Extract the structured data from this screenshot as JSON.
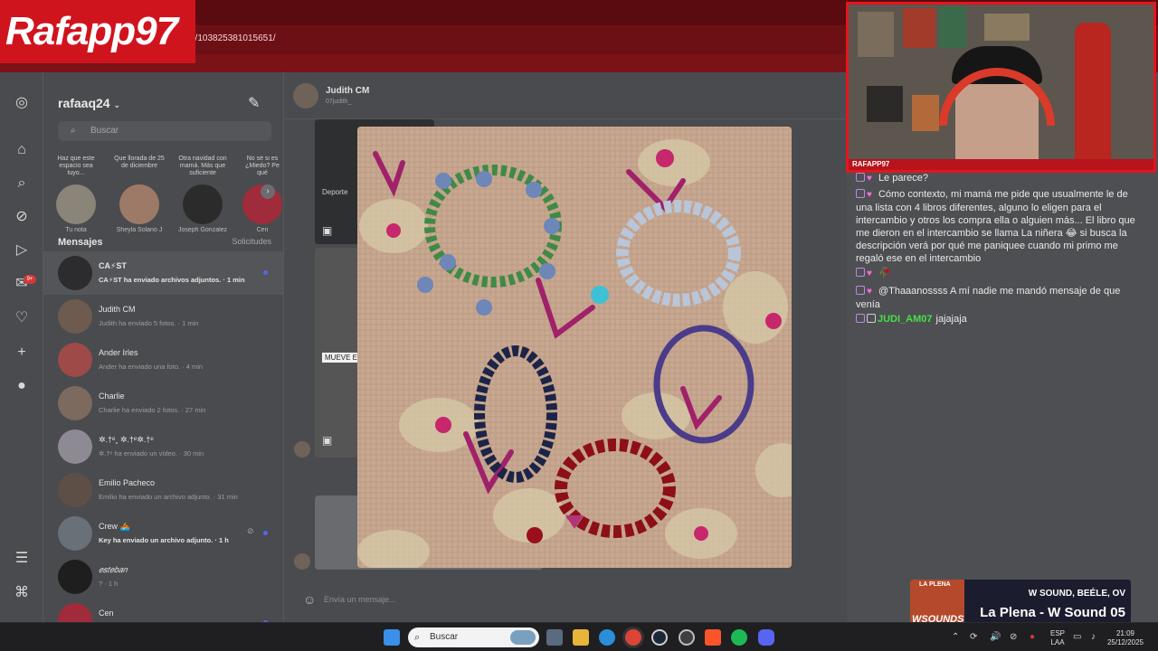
{
  "browser": {
    "url": "/t/103825381015651/",
    "overlay_logo": "Rafapp97"
  },
  "sidebar_rail": {
    "icons": [
      "instagram-icon",
      "home-icon",
      "search-icon",
      "explore-icon",
      "reels-icon",
      "messenger-icon",
      "heart-icon",
      "plus-icon",
      "profile-icon",
      "menu-icon",
      "threads-icon"
    ],
    "badge": "9+"
  },
  "inbox": {
    "username": "rafaaq24",
    "search_placeholder": "Buscar",
    "notes": [
      {
        "bubble": "Haz que este espacio sea tuyo...",
        "name": "Tu nota"
      },
      {
        "bubble": "Que llorada de 25 de diciembre",
        "name": "Sheyla Solano J"
      },
      {
        "bubble": "Otra navidad con mamá. Más que suficiente",
        "name": "Joseph Gonzalez"
      },
      {
        "bubble": "No sé si es ¿Miedo? Pe qué",
        "name": "Cen"
      }
    ],
    "messages_label": "Mensajes",
    "requests_label": "Solicitudes",
    "conversations": [
      {
        "name": "CA⚡ST",
        "preview": "CA⚡ST ha enviado archivos adjuntos. · 1 min",
        "unread": true,
        "active": true
      },
      {
        "name": "Judith CM",
        "preview": "Judith ha enviado 5 fotos. · 1 min",
        "unread": false,
        "active": false
      },
      {
        "name": "Ander Irles",
        "preview": "Ander ha enviado una foto. · 4 min",
        "unread": false,
        "active": false
      },
      {
        "name": "Charlie",
        "preview": "Charlie ha enviado 2 fotos. · 27 min",
        "unread": false,
        "active": false
      },
      {
        "name": "✲.†ᵉ˳ ✲.†ᵉ✲.†ᵉ",
        "preview": "✲.†ᵉ ha enviado un vídeo. · 30 min",
        "unread": false,
        "active": false
      },
      {
        "name": "Emilio Pacheco",
        "preview": "Emilio ha enviado un archivo adjunto. · 31 min",
        "unread": false,
        "active": false
      },
      {
        "name": "Crew 🚣",
        "preview": "Key ha enviado un archivo adjunto. · 1 h",
        "unread": true,
        "active": false
      },
      {
        "name": "𝑒𝑠𝑡𝑒𝑏𝑎𝑛",
        "preview": "? · 1 h",
        "unread": false,
        "active": false
      },
      {
        "name": "Cen",
        "preview": "",
        "unread": true,
        "active": false
      }
    ]
  },
  "chat": {
    "name": "Judith CM",
    "handle": "07judith_",
    "thumb1_text": "MUEVE E",
    "thumb2_text": "Deporte",
    "input_placeholder": "Envía un mensaje..."
  },
  "twitch_chat": {
    "lines": [
      {
        "user": "",
        "text": "Le parece?",
        "heart": true
      },
      {
        "user": "",
        "text": "Cómo contexto, mi mamá me pide que usualmente le de una lista con 4 libros diferentes, alguno lo eligen para el intercambio y otros los compra ella o alguien más... El libro que me dieron en el intercambio se llama La niñera 😂 si busca la descripción verá por qué me paniquee cuando mi primo me regaló ese en el intercambio",
        "heart": true
      },
      {
        "user": "",
        "text": "🥀",
        "heart": true
      },
      {
        "user": "",
        "text": "@Thaaanossss A mí nadie me mandó mensaje de que venía",
        "heart": true
      },
      {
        "user": "JUDI_AM07",
        "text": "jajajaja",
        "heart": false
      }
    ]
  },
  "webcam": {
    "tag": "RAFAPP97"
  },
  "music": {
    "cover_top": "LA PLENA",
    "cover_label": "WSOUNDS",
    "artists": "W SOUND, BEÉLE, OV",
    "title": "La Plena - W Sound 05"
  },
  "taskbar": {
    "search_placeholder": "Buscar",
    "lang_top": "ESP",
    "lang_bottom": "LAA",
    "time": "21:09",
    "date": "25/12/2025",
    "colors": {
      "chrome": "#db4437",
      "spotify": "#1db954",
      "discord": "#5865f2",
      "brave": "#fb542b",
      "steam": "#1b2838"
    }
  }
}
